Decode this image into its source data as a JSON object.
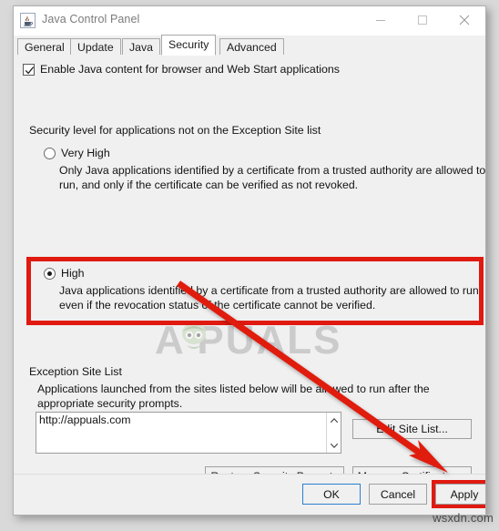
{
  "window": {
    "title": "Java Control Panel",
    "icon": "java-coffee-cup-icon",
    "controls": {
      "minimize": "minimize-icon",
      "maximize": "maximize-icon",
      "close": "close-icon"
    }
  },
  "tabs": [
    {
      "label": "General",
      "active": false
    },
    {
      "label": "Update",
      "active": false
    },
    {
      "label": "Java",
      "active": false
    },
    {
      "label": "Security",
      "active": true
    },
    {
      "label": "Advanced",
      "active": false
    }
  ],
  "security": {
    "enable_checkbox": {
      "label": "Enable Java content for browser and Web Start applications",
      "checked": true
    },
    "level_heading": "Security level for applications not on the Exception Site list",
    "levels": [
      {
        "label": "Very High",
        "selected": false,
        "description": "Only Java applications identified by a certificate from a trusted authority are allowed to run, and only if the certificate can be verified as not revoked."
      },
      {
        "label": "High",
        "selected": true,
        "description": "Java applications identified by a certificate from a trusted authority are allowed to run, even if the revocation status of the certificate cannot be verified."
      }
    ]
  },
  "exception_site_list": {
    "title": "Exception Site List",
    "description": "Applications launched from the sites listed below will be allowed to run after the appropriate security prompts.",
    "sites": [
      "http://appuals.com"
    ],
    "scrollbar": {
      "up": "chevron-up-icon",
      "down": "chevron-down-icon"
    },
    "edit_button": "Edit Site List..."
  },
  "action_buttons": {
    "restore": "Restore Security Prompts",
    "manage": "Manage Certificates..."
  },
  "dialog_buttons": {
    "ok": "OK",
    "cancel": "Cancel",
    "apply": "Apply"
  },
  "annotations": {
    "highlight_color": "#e01a10",
    "arrow": "red-arrow-pointing-to-apply",
    "watermark": "APPUALS",
    "source_watermark": "wsxdn.com"
  }
}
